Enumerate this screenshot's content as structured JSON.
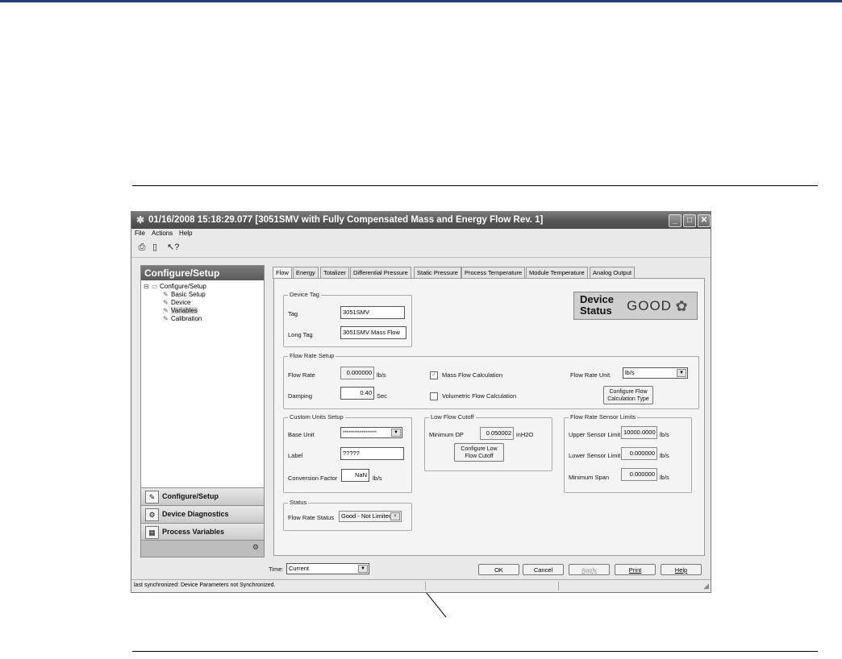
{
  "window": {
    "title": "01/16/2008 15:18:29.077 [3051SMV with Fully Compensated Mass and Energy Flow Rev. 1]",
    "menu": [
      "File",
      "Actions",
      "Help"
    ]
  },
  "toolbar": {
    "icons": [
      "print-icon",
      "print-preview-icon",
      "help-pointer-icon"
    ]
  },
  "left_panel": {
    "title": "Configure/Setup",
    "tree_root": "Configure/Setup",
    "tree_items": [
      "Basic Setup",
      "Device",
      "Variables",
      "Calibration"
    ],
    "nav": [
      "Configure/Setup",
      "Device Diagnostics",
      "Process Variables"
    ]
  },
  "tabs": [
    "Flow",
    "Energy",
    "Totalizer",
    "Differential Pressure",
    "Static Pressure",
    "Process Temperature",
    "Module Temperature",
    "Analog Output"
  ],
  "device_tag": {
    "group": "Device Tag",
    "tag_label": "Tag",
    "tag_value": "3051SMV",
    "long_tag_label": "Long Tag",
    "long_tag_value": "3051SMV Mass Flow"
  },
  "device_status": {
    "label_line1": "Device",
    "label_line2": "Status",
    "value": "GOOD"
  },
  "flow_rate_setup": {
    "group": "Flow Rate Setup",
    "flow_rate_label": "Flow Rate",
    "flow_rate_value": "0.000000",
    "flow_rate_unit": "lb/s",
    "damping_label": "Damping",
    "damping_value": "0.40",
    "damping_unit": "Sec",
    "mass_flow_label": "Mass Flow Calculation",
    "mass_flow_checked": true,
    "volumetric_label": "Volumetric Flow Calculation",
    "volumetric_checked": false,
    "flow_rate_unit_label": "Flow Rate Unit",
    "flow_rate_unit_value": "lb/s",
    "configure_button_line1": "Configure Flow",
    "configure_button_line2": "Calculation Type"
  },
  "custom_units": {
    "group": "Custom Units Setup",
    "base_unit_label": "Base Unit",
    "base_unit_value": "******************",
    "label_label": "Label",
    "label_value": "?????",
    "conversion_label": "Conversion Factor",
    "conversion_value": "NaN",
    "conversion_unit": "lb/s"
  },
  "low_flow_cutoff": {
    "group": "Low Flow Cutoff",
    "min_dp_label": "Minimum DP",
    "min_dp_value": "0.050002",
    "min_dp_unit": "inH2O",
    "button_line1": "Configure Low",
    "button_line2": "Flow Cutoff"
  },
  "sensor_limits": {
    "group": "Flow Rate Sensor Limits",
    "upper_label": "Upper Sensor Limit",
    "upper_value": "10000.0000",
    "upper_unit": "lb/s",
    "lower_label": "Lower Sensor Limit",
    "lower_value": "0.000000",
    "lower_unit": "lb/s",
    "span_label": "Minimum Span",
    "span_value": "0.000000",
    "span_unit": "lb/s"
  },
  "status": {
    "group": "Status",
    "flow_rate_status_label": "Flow Rate Status",
    "flow_rate_status_value": "Good - Not Limitec"
  },
  "bottom": {
    "time_label": "Time:",
    "time_value": "Current",
    "ok": "OK",
    "cancel": "Cancel",
    "apply": "Apply",
    "print": "Print",
    "help": "Help"
  },
  "statusbar": {
    "text": "last synchronized: Device Parameters not Synchronized."
  },
  "colors": {
    "title_bar": "#555555",
    "rule_top": "#1f3f6e"
  }
}
